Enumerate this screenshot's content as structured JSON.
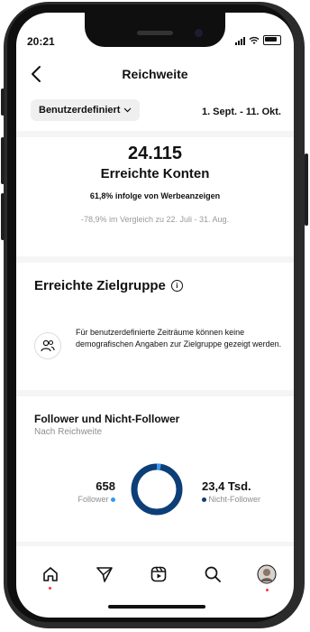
{
  "status_bar": {
    "time": "20:21"
  },
  "header": {
    "title": "Reichweite"
  },
  "filter": {
    "dropdown_label": "Benutzerdefiniert",
    "date_range": "1. Sept. - 11. Okt."
  },
  "reach": {
    "number": "24.115",
    "label": "Erreichte Konten",
    "ads_share": "61,8% infolge von Werbeanzeigen",
    "comparison": "-78,9% im Vergleich zu 22. Juli - 31. Aug."
  },
  "audience": {
    "title": "Erreichte Zielgruppe",
    "notice": "Für benutzerdefinierte Zeiträume können keine demografischen Angaben zur Zielgruppe gezeigt werden."
  },
  "followers_section": {
    "title": "Follower und Nicht-Follower",
    "subtitle": "Nach Reichweite",
    "followers_value": "658",
    "followers_label": "Follower",
    "non_followers_value": "23,4 Tsd.",
    "non_followers_label": "Nicht-Follower",
    "follower_share": 0.027,
    "follower_color": "#3897f0",
    "non_follower_color": "#0d3e78"
  },
  "tabbar": {
    "items": [
      "home-icon",
      "send-icon",
      "reels-icon",
      "search-icon",
      "profile-avatar"
    ]
  },
  "colors": {
    "accent_red": "#ff3040",
    "separator": "#f5f5f5"
  }
}
